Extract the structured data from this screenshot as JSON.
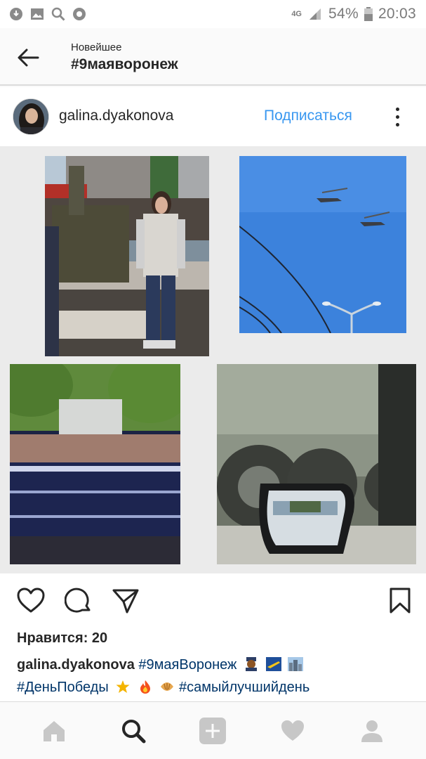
{
  "status_bar": {
    "network": "4G",
    "battery": "54%",
    "time": "20:03",
    "icons": [
      "cloud-download-icon",
      "image-icon",
      "search-icon",
      "record-icon",
      "signal-icon",
      "battery-icon"
    ]
  },
  "header": {
    "subtitle": "Новейшее",
    "title": "#9маяворонеж",
    "back_icon": "back-arrow-icon"
  },
  "post": {
    "username": "galina.dyakonova",
    "follow_label": "Подписаться",
    "more_icon": "more-vertical-icon",
    "images": [
      {
        "name": "photo-woman-at-parade"
      },
      {
        "name": "photo-helicopters-sky"
      },
      {
        "name": "photo-military-crowd"
      },
      {
        "name": "photo-armored-vehicle-mirror"
      }
    ],
    "likes": "Нравится: 20",
    "caption": {
      "username": "galina.dyakonova",
      "tag1": "#9маяВоронеж",
      "tag2": "#ДеньПобеды",
      "tag3": "#самыйлучшийдень"
    }
  },
  "bottom_nav": {
    "items": [
      "home-icon",
      "search-icon",
      "add-icon",
      "heart-icon",
      "profile-icon"
    ]
  },
  "colors": {
    "accent": "#3897f0",
    "hashtag": "#003569",
    "text": "#262626",
    "background": "#fafafa"
  }
}
